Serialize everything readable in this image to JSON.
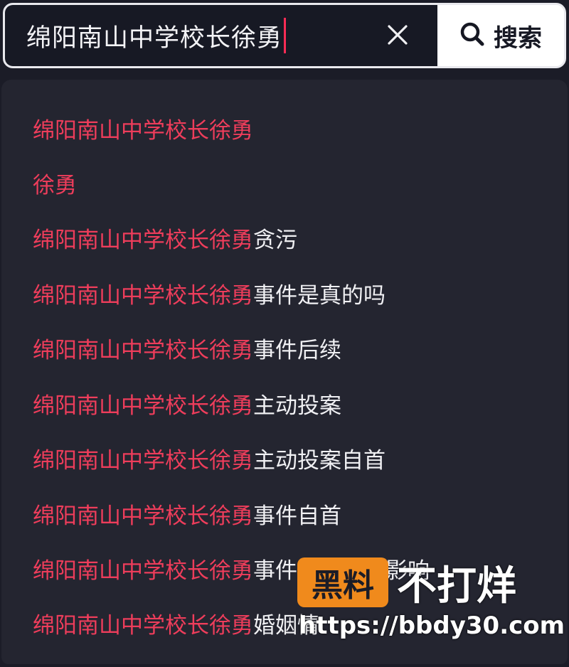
{
  "search": {
    "query": "绵阳南山中学校长徐勇",
    "button_label": "搜索"
  },
  "suggestions": [
    {
      "highlight": "绵阳南山中学校长徐勇",
      "rest": ""
    },
    {
      "highlight": "徐勇",
      "rest": ""
    },
    {
      "highlight": "绵阳南山中学校长徐勇",
      "rest": "贪污"
    },
    {
      "highlight": "绵阳南山中学校长徐勇",
      "rest": "事件是真的吗"
    },
    {
      "highlight": "绵阳南山中学校长徐勇",
      "rest": "事件后续"
    },
    {
      "highlight": "绵阳南山中学校长徐勇",
      "rest": "主动投案"
    },
    {
      "highlight": "绵阳南山中学校长徐勇",
      "rest": "主动投案自首"
    },
    {
      "highlight": "绵阳南山中学校长徐勇",
      "rest": "事件自首"
    },
    {
      "highlight": "绵阳南山中学校长徐勇",
      "rest": "事件对学生的影响"
    },
    {
      "highlight": "绵阳南山中学校长徐勇",
      "rest": "婚姻情"
    }
  ],
  "watermark": {
    "badge": "黑料",
    "text": "不打烊",
    "url": "https://bbdy30.com"
  },
  "colors": {
    "highlight": "#ee3d5b",
    "caret": "#fe2c55",
    "panel_bg": "#242530",
    "watermark_badge": "#f08a1c"
  }
}
